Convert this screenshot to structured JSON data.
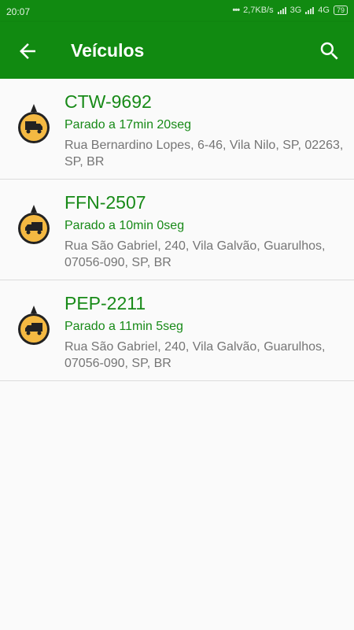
{
  "statusbar": {
    "time": "20:07",
    "speed": "2,7KB/s",
    "network1": "3G",
    "network2": "4G",
    "battery": "79"
  },
  "appbar": {
    "title": "Veículos",
    "back_icon": "arrow-back-icon",
    "search_icon": "search-icon"
  },
  "colors": {
    "primary": "#118a11",
    "text_green": "#188a18",
    "address_gray": "#757575",
    "marker_yellow": "#f4b942"
  },
  "vehicles": [
    {
      "plate": "CTW-9692",
      "status": "Parado a 17min 20seg",
      "address": "Rua Bernardino Lopes, 6-46, Vila Nilo, SP, 02263, SP, BR"
    },
    {
      "plate": "FFN-2507",
      "status": "Parado a 10min 0seg",
      "address": "Rua São Gabriel, 240, Vila Galvão, Guarulhos, 07056-090, SP, BR"
    },
    {
      "plate": "PEP-2211",
      "status": "Parado a 11min 5seg",
      "address": "Rua São Gabriel, 240, Vila Galvão, Guarulhos, 07056-090, SP, BR"
    }
  ]
}
